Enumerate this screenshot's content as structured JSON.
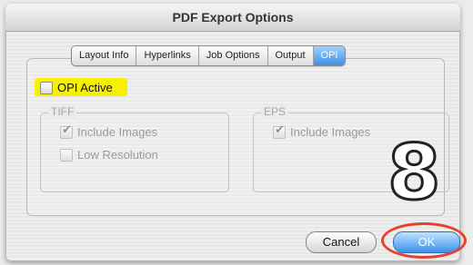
{
  "window": {
    "title": "PDF Export Options"
  },
  "tabs": [
    {
      "label": "Layout Info",
      "selected": false
    },
    {
      "label": "Hyperlinks",
      "selected": false
    },
    {
      "label": "Job Options",
      "selected": false
    },
    {
      "label": "Output",
      "selected": false
    },
    {
      "label": "OPI",
      "selected": true
    }
  ],
  "opi_active": {
    "label": "OPI Active",
    "checked": false,
    "highlight_color": "#f7f000"
  },
  "tiff": {
    "label": "TIFF",
    "include_images": {
      "label": "Include Images",
      "checked": true,
      "enabled": false
    },
    "low_resolution": {
      "label": "Low Resolution",
      "checked": false,
      "enabled": false
    }
  },
  "eps": {
    "label": "EPS",
    "include_images": {
      "label": "Include Images",
      "checked": true,
      "enabled": false
    }
  },
  "overlay": {
    "step_number": "8",
    "ring_color": "#e8402a"
  },
  "buttons": {
    "cancel": "Cancel",
    "ok": "OK"
  },
  "colors": {
    "accent": "#3b91ea"
  }
}
